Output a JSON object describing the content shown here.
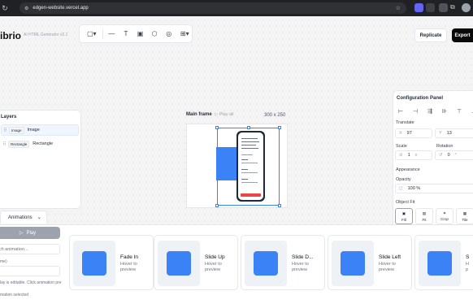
{
  "browser": {
    "url": "edgen-website.vercel.app"
  },
  "app": {
    "brand": "ibrio",
    "subtitle": "AI HTML Generator v2.1",
    "replicate_label": "Replicate",
    "export_label": "Export"
  },
  "toolbar": {
    "tools": [
      {
        "icon": "frame-icon",
        "glyph": "▢▾"
      },
      {
        "icon": "line-icon",
        "glyph": "—"
      },
      {
        "icon": "text-icon",
        "glyph": "T"
      },
      {
        "icon": "image-icon",
        "glyph": "▣"
      },
      {
        "icon": "shape-icon",
        "glyph": "⬡"
      },
      {
        "icon": "component-icon",
        "glyph": "◎"
      },
      {
        "icon": "grid-icon",
        "glyph": "⊞▾"
      }
    ]
  },
  "layers": {
    "title": "Layers",
    "items": [
      {
        "tag": "Image",
        "name": "Image",
        "selected": true
      },
      {
        "tag": "Rectangle",
        "name": "Rectangle",
        "selected": false
      }
    ]
  },
  "frame": {
    "label": "Main frame",
    "play_all": "Play all",
    "size": "300 x 250"
  },
  "config": {
    "title": "Configuration Panel",
    "translate_label": "Translate",
    "x_label": "X",
    "x_value": "97",
    "y_label": "Y",
    "y_value": "13",
    "scale_label": "Scale",
    "scale_value": "1",
    "scale_unit": "x",
    "rotation_label": "Rotation",
    "rotation_value": "0",
    "rotation_unit": "°",
    "appearance_label": "Appearance",
    "opacity_label": "Opacity",
    "opacity_value": "100 %",
    "objectfit_label": "Object Fit",
    "fit_options": [
      "Fill",
      "Fit",
      "Crop",
      "Tile"
    ]
  },
  "animations": {
    "tab_label": "Animations",
    "play_label": "Play",
    "search_placeholder": "rch animation...",
    "field_label": "me)",
    "editable_hint": "lay is editable. Click animation pre",
    "selected_hint": "mation selected",
    "cards": [
      {
        "name": "Fade In",
        "hint": "Hover to preview"
      },
      {
        "name": "Slide Up",
        "hint": "Hover to preview"
      },
      {
        "name": "Slide D...",
        "hint": "Hover to preview"
      },
      {
        "name": "Slide Left",
        "hint": "Hover to preview"
      },
      {
        "name": "S",
        "hint": "H p"
      }
    ]
  },
  "colors": {
    "accent": "#3b82f6",
    "dark": "#0a0a0a"
  }
}
